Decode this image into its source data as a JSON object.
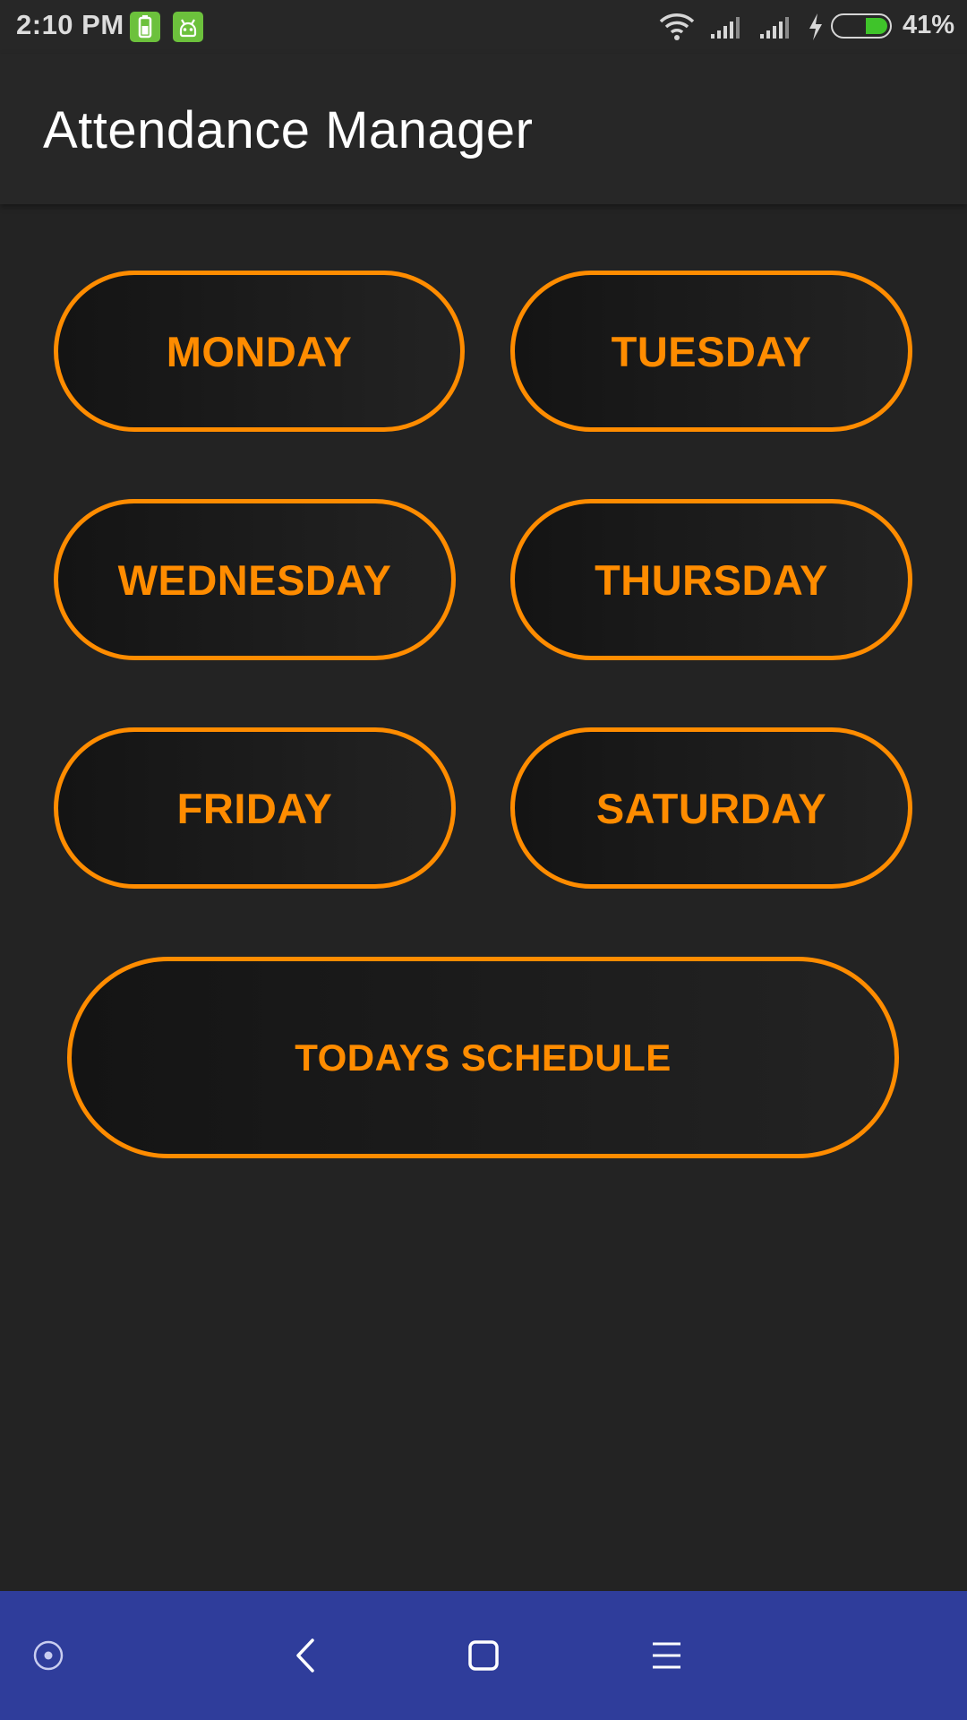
{
  "status_bar": {
    "time": "2:10 PM",
    "battery_percent": "41%",
    "battery_level": 0.41,
    "icons": [
      "battery-app-icon",
      "android-app-icon",
      "wifi-icon",
      "signal-icon",
      "signal-icon",
      "charging-icon",
      "battery-icon"
    ]
  },
  "app_bar": {
    "title": "Attendance Manager"
  },
  "buttons": {
    "monday": "MONDAY",
    "tuesday": "TUESDAY",
    "wednesday": "WEDNESDAY",
    "thursday": "THURSDAY",
    "friday": "FRIDAY",
    "saturday": "SATURDAY",
    "todays_schedule": "TODAYS SCHEDULE"
  },
  "nav_bar": {
    "icons": [
      "assistant-icon",
      "back-icon",
      "home-icon",
      "menu-icon"
    ]
  },
  "colors": {
    "accent": "#ff8c00",
    "background": "#232323",
    "app_bar": "#272727",
    "nav_bar": "#2f3d9b",
    "battery_fill": "#3fc42a"
  }
}
